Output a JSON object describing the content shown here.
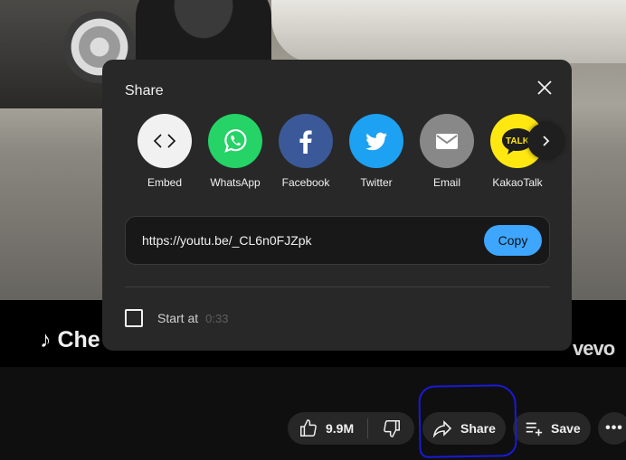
{
  "background": {
    "title_fragment": "♪ Che",
    "channel_logo": "vevo"
  },
  "actions": {
    "like_count": "9.9M",
    "share_label": "Share",
    "save_label": "Save",
    "more_label": "•••"
  },
  "share_dialog": {
    "title": "Share",
    "targets": [
      {
        "label": "Embed",
        "icon": "embed-icon",
        "color": "#f1f1f1"
      },
      {
        "label": "WhatsApp",
        "icon": "whatsapp-icon",
        "color": "#25d366"
      },
      {
        "label": "Facebook",
        "icon": "facebook-icon",
        "color": "#3b5998"
      },
      {
        "label": "Twitter",
        "icon": "twitter-icon",
        "color": "#1da1f2"
      },
      {
        "label": "Email",
        "icon": "email-icon",
        "color": "#888888"
      },
      {
        "label": "KakaoTalk",
        "icon": "kakaotalk-icon",
        "color": "#ffe812",
        "glyph": "TALK"
      }
    ],
    "url": "https://youtu.be/_CL6n0FJZpk",
    "copy_label": "Copy",
    "start_at_label": "Start at",
    "start_at_time": "0:33",
    "accent_color": "#3ea6ff"
  }
}
